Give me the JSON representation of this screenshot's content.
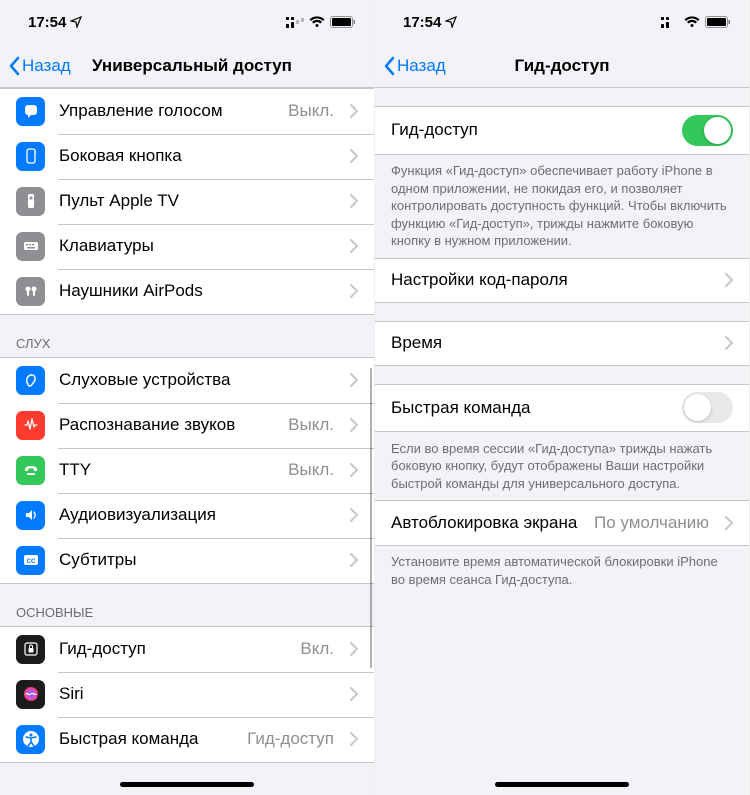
{
  "status": {
    "time": "17:54"
  },
  "left": {
    "back": "Назад",
    "title": "Универсальный доступ",
    "groups": [
      {
        "items": [
          {
            "iconName": "voice-icon",
            "bg": "#007aff",
            "glyph": "mic-bubble",
            "label": "Управление голосом",
            "value": "Выкл."
          },
          {
            "iconName": "side-button-icon",
            "bg": "#007aff",
            "glyph": "side-btn",
            "label": "Боковая кнопка",
            "value": ""
          },
          {
            "iconName": "apple-tv-icon",
            "bg": "#8e8e93",
            "glyph": "remote",
            "label": "Пульт Apple TV",
            "value": ""
          },
          {
            "iconName": "keyboard-icon",
            "bg": "#8e8e93",
            "glyph": "keyboard",
            "label": "Клавиатуры",
            "value": ""
          },
          {
            "iconName": "airpods-icon",
            "bg": "#8e8e93",
            "glyph": "airpods",
            "label": "Наушники AirPods",
            "value": ""
          }
        ]
      },
      {
        "header": "СЛУХ",
        "items": [
          {
            "iconName": "hearing-icon",
            "bg": "#007aff",
            "glyph": "ear",
            "label": "Слуховые устройства",
            "value": ""
          },
          {
            "iconName": "sound-rec-icon",
            "bg": "#ff3b30",
            "glyph": "wave",
            "label": "Распознавание звуков",
            "value": "Выкл."
          },
          {
            "iconName": "tty-icon",
            "bg": "#34c759",
            "glyph": "tty",
            "label": "TTY",
            "value": "Выкл."
          },
          {
            "iconName": "audio-vis-icon",
            "bg": "#007aff",
            "glyph": "speaker",
            "label": "Аудиовизуализация",
            "value": ""
          },
          {
            "iconName": "subtitles-icon",
            "bg": "#007aff",
            "glyph": "cc",
            "label": "Субтитры",
            "value": ""
          }
        ]
      },
      {
        "header": "ОСНОВНЫЕ",
        "items": [
          {
            "iconName": "guided-access-icon",
            "bg": "#1c1c1e",
            "glyph": "lock",
            "label": "Гид-доступ",
            "value": "Вкл."
          },
          {
            "iconName": "siri-icon",
            "bg": "#1c1c1e",
            "glyph": "siri",
            "label": "Siri",
            "value": ""
          },
          {
            "iconName": "shortcut-icon",
            "bg": "#007aff",
            "glyph": "accessibility",
            "label": "Быстрая команда",
            "value": "Гид-доступ"
          }
        ]
      }
    ]
  },
  "right": {
    "back": "Назад",
    "title": "Гид-доступ",
    "rows": {
      "guided": {
        "label": "Гид-доступ",
        "on": true
      },
      "guidedFooter": "Функция «Гид-доступ» обеспечивает работу iPhone в одном приложении, не покидая его, и позволяет контролировать доступность функций. Чтобы включить функцию «Гид-доступ», трижды нажмите боковую кнопку в нужном приложении.",
      "passcode": {
        "label": "Настройки код-пароля"
      },
      "time": {
        "label": "Время"
      },
      "shortcut": {
        "label": "Быстрая команда",
        "on": false
      },
      "shortcutFooter": "Если во время сессии «Гид-доступа» трижды нажать боковую кнопку, будут отображены Ваши настройки быстрой команды для универсального доступа.",
      "autolock": {
        "label": "Автоблокировка экрана",
        "value": "По умолчанию"
      },
      "autolockFooter": "Установите время автоматической блокировки iPhone во время сеанса Гид-доступа."
    }
  }
}
